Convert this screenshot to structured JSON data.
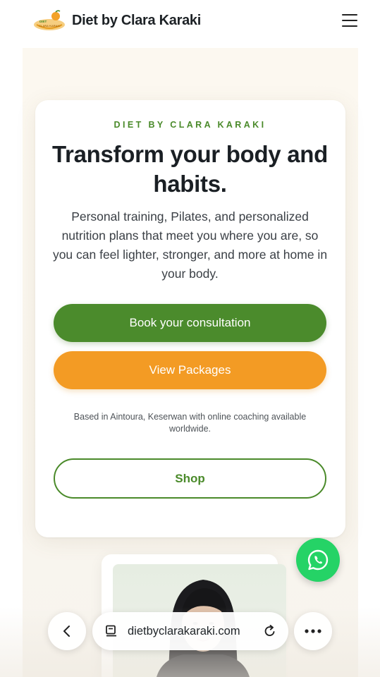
{
  "header": {
    "logo_text": "DIET CLARA KARAKI",
    "brand": "Diet by Clara Karaki",
    "menu_icon": "hamburger-menu-icon"
  },
  "hero": {
    "eyebrow": "DIET BY CLARA KARAKI",
    "title": "Transform your body and habits.",
    "subtitle": "Personal training, Pilates, and personalized nutrition plans that meet you where you are, so you can feel lighter, stronger, and more at home in your body.",
    "primary_cta": "Book your consultation",
    "secondary_cta": "View Packages",
    "location_note": "Based in Aintoura, Keserwan with online coaching available worldwide.",
    "shop_cta": "Shop"
  },
  "colors": {
    "green": "#4b8b2c",
    "orange": "#f39b24",
    "whatsapp": "#25d366"
  },
  "whatsapp": {
    "icon": "whatsapp-icon"
  },
  "browser_bar": {
    "back_icon": "chevron-left-icon",
    "page_icon": "page-info-icon",
    "url": "dietbyclarakaraki.com",
    "reload_icon": "reload-icon",
    "more_icon": "more-dots-icon"
  }
}
